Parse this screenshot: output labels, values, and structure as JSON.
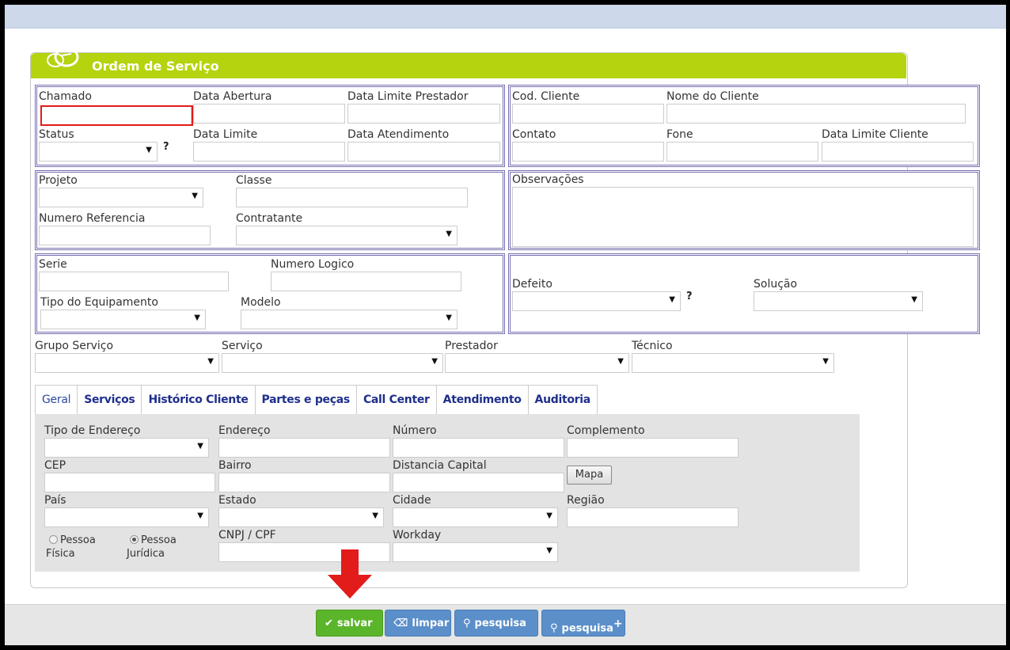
{
  "header": {
    "title": "Ordem de Serviço"
  },
  "box1": {
    "chamado": "Chamado",
    "data_abertura": "Data Abertura",
    "data_limite_prestador": "Data Limite Prestador",
    "status": "Status",
    "data_limite": "Data Limite",
    "data_atendimento": "Data Atendimento",
    "help": "?"
  },
  "box2": {
    "cod_cliente": "Cod. Cliente",
    "nome_cliente": "Nome do Cliente",
    "contato": "Contato",
    "fone": "Fone",
    "data_limite_cliente": "Data Limite Cliente"
  },
  "box3": {
    "projeto": "Projeto",
    "classe": "Classe",
    "numero_referencia": "Numero Referencia",
    "contratante": "Contratante"
  },
  "box4": {
    "observacoes": "Observações"
  },
  "box5": {
    "serie": "Serie",
    "numero_logico": "Numero Logico",
    "tipo_equipamento": "Tipo do Equipamento",
    "modelo": "Modelo"
  },
  "box6": {
    "defeito": "Defeito",
    "solucao": "Solução",
    "help": "?"
  },
  "service_row": {
    "grupo_servico": "Grupo Serviço",
    "servico": "Serviço",
    "prestador": "Prestador",
    "tecnico": "Técnico"
  },
  "tabs": [
    {
      "label": "Geral"
    },
    {
      "label": "Serviços"
    },
    {
      "label": "Histórico Cliente"
    },
    {
      "label": "Partes e peças"
    },
    {
      "label": "Call Center"
    },
    {
      "label": "Atendimento"
    },
    {
      "label": "Auditoria"
    }
  ],
  "geral": {
    "tipo_endereco": "Tipo de Endereço",
    "endereco": "Endereço",
    "numero": "Número",
    "complemento": "Complemento",
    "cep": "CEP",
    "bairro": "Bairro",
    "distancia_capital": "Distancia Capital",
    "mapa_button": "Mapa",
    "pais": "País",
    "estado": "Estado",
    "cidade": "Cidade",
    "regiao": "Região",
    "cnpj_cpf": "CNPJ / CPF",
    "workday": "Workday",
    "radio_fisica_1": "Pessoa",
    "radio_fisica_2": "Física",
    "radio_juridica_1": "Pessoa",
    "radio_juridica_2": "Jurídica"
  },
  "footer": {
    "salvar": "salvar",
    "limpar": "limpar",
    "pesquisa": "pesquisa",
    "pesquisa_plus": "pesquisa",
    "plus": "+"
  },
  "colors": {
    "header_green": "#b5d30e",
    "box_border": "#7670b0",
    "salvar_green": "#5bb52a",
    "button_blue": "#5b8fc9",
    "highlight_red": "#e21b1b"
  }
}
